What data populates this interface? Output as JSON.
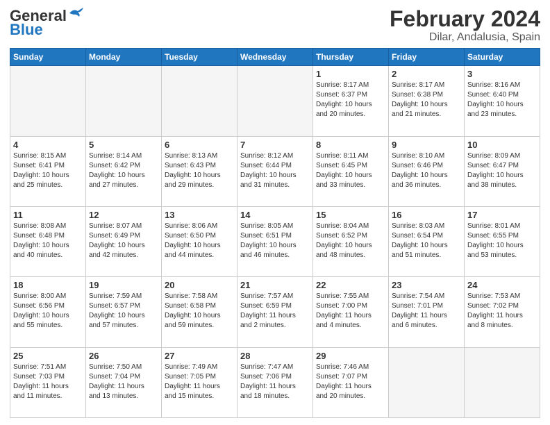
{
  "logo": {
    "line1": "General",
    "line2": "Blue"
  },
  "title": "February 2024",
  "subtitle": "Dilar, Andalusia, Spain",
  "weekdays": [
    "Sunday",
    "Monday",
    "Tuesday",
    "Wednesday",
    "Thursday",
    "Friday",
    "Saturday"
  ],
  "weeks": [
    [
      {
        "day": "",
        "info": ""
      },
      {
        "day": "",
        "info": ""
      },
      {
        "day": "",
        "info": ""
      },
      {
        "day": "",
        "info": ""
      },
      {
        "day": "1",
        "info": "Sunrise: 8:17 AM\nSunset: 6:37 PM\nDaylight: 10 hours\nand 20 minutes."
      },
      {
        "day": "2",
        "info": "Sunrise: 8:17 AM\nSunset: 6:38 PM\nDaylight: 10 hours\nand 21 minutes."
      },
      {
        "day": "3",
        "info": "Sunrise: 8:16 AM\nSunset: 6:40 PM\nDaylight: 10 hours\nand 23 minutes."
      }
    ],
    [
      {
        "day": "4",
        "info": "Sunrise: 8:15 AM\nSunset: 6:41 PM\nDaylight: 10 hours\nand 25 minutes."
      },
      {
        "day": "5",
        "info": "Sunrise: 8:14 AM\nSunset: 6:42 PM\nDaylight: 10 hours\nand 27 minutes."
      },
      {
        "day": "6",
        "info": "Sunrise: 8:13 AM\nSunset: 6:43 PM\nDaylight: 10 hours\nand 29 minutes."
      },
      {
        "day": "7",
        "info": "Sunrise: 8:12 AM\nSunset: 6:44 PM\nDaylight: 10 hours\nand 31 minutes."
      },
      {
        "day": "8",
        "info": "Sunrise: 8:11 AM\nSunset: 6:45 PM\nDaylight: 10 hours\nand 33 minutes."
      },
      {
        "day": "9",
        "info": "Sunrise: 8:10 AM\nSunset: 6:46 PM\nDaylight: 10 hours\nand 36 minutes."
      },
      {
        "day": "10",
        "info": "Sunrise: 8:09 AM\nSunset: 6:47 PM\nDaylight: 10 hours\nand 38 minutes."
      }
    ],
    [
      {
        "day": "11",
        "info": "Sunrise: 8:08 AM\nSunset: 6:48 PM\nDaylight: 10 hours\nand 40 minutes."
      },
      {
        "day": "12",
        "info": "Sunrise: 8:07 AM\nSunset: 6:49 PM\nDaylight: 10 hours\nand 42 minutes."
      },
      {
        "day": "13",
        "info": "Sunrise: 8:06 AM\nSunset: 6:50 PM\nDaylight: 10 hours\nand 44 minutes."
      },
      {
        "day": "14",
        "info": "Sunrise: 8:05 AM\nSunset: 6:51 PM\nDaylight: 10 hours\nand 46 minutes."
      },
      {
        "day": "15",
        "info": "Sunrise: 8:04 AM\nSunset: 6:52 PM\nDaylight: 10 hours\nand 48 minutes."
      },
      {
        "day": "16",
        "info": "Sunrise: 8:03 AM\nSunset: 6:54 PM\nDaylight: 10 hours\nand 51 minutes."
      },
      {
        "day": "17",
        "info": "Sunrise: 8:01 AM\nSunset: 6:55 PM\nDaylight: 10 hours\nand 53 minutes."
      }
    ],
    [
      {
        "day": "18",
        "info": "Sunrise: 8:00 AM\nSunset: 6:56 PM\nDaylight: 10 hours\nand 55 minutes."
      },
      {
        "day": "19",
        "info": "Sunrise: 7:59 AM\nSunset: 6:57 PM\nDaylight: 10 hours\nand 57 minutes."
      },
      {
        "day": "20",
        "info": "Sunrise: 7:58 AM\nSunset: 6:58 PM\nDaylight: 10 hours\nand 59 minutes."
      },
      {
        "day": "21",
        "info": "Sunrise: 7:57 AM\nSunset: 6:59 PM\nDaylight: 11 hours\nand 2 minutes."
      },
      {
        "day": "22",
        "info": "Sunrise: 7:55 AM\nSunset: 7:00 PM\nDaylight: 11 hours\nand 4 minutes."
      },
      {
        "day": "23",
        "info": "Sunrise: 7:54 AM\nSunset: 7:01 PM\nDaylight: 11 hours\nand 6 minutes."
      },
      {
        "day": "24",
        "info": "Sunrise: 7:53 AM\nSunset: 7:02 PM\nDaylight: 11 hours\nand 8 minutes."
      }
    ],
    [
      {
        "day": "25",
        "info": "Sunrise: 7:51 AM\nSunset: 7:03 PM\nDaylight: 11 hours\nand 11 minutes."
      },
      {
        "day": "26",
        "info": "Sunrise: 7:50 AM\nSunset: 7:04 PM\nDaylight: 11 hours\nand 13 minutes."
      },
      {
        "day": "27",
        "info": "Sunrise: 7:49 AM\nSunset: 7:05 PM\nDaylight: 11 hours\nand 15 minutes."
      },
      {
        "day": "28",
        "info": "Sunrise: 7:47 AM\nSunset: 7:06 PM\nDaylight: 11 hours\nand 18 minutes."
      },
      {
        "day": "29",
        "info": "Sunrise: 7:46 AM\nSunset: 7:07 PM\nDaylight: 11 hours\nand 20 minutes."
      },
      {
        "day": "",
        "info": ""
      },
      {
        "day": "",
        "info": ""
      }
    ]
  ]
}
